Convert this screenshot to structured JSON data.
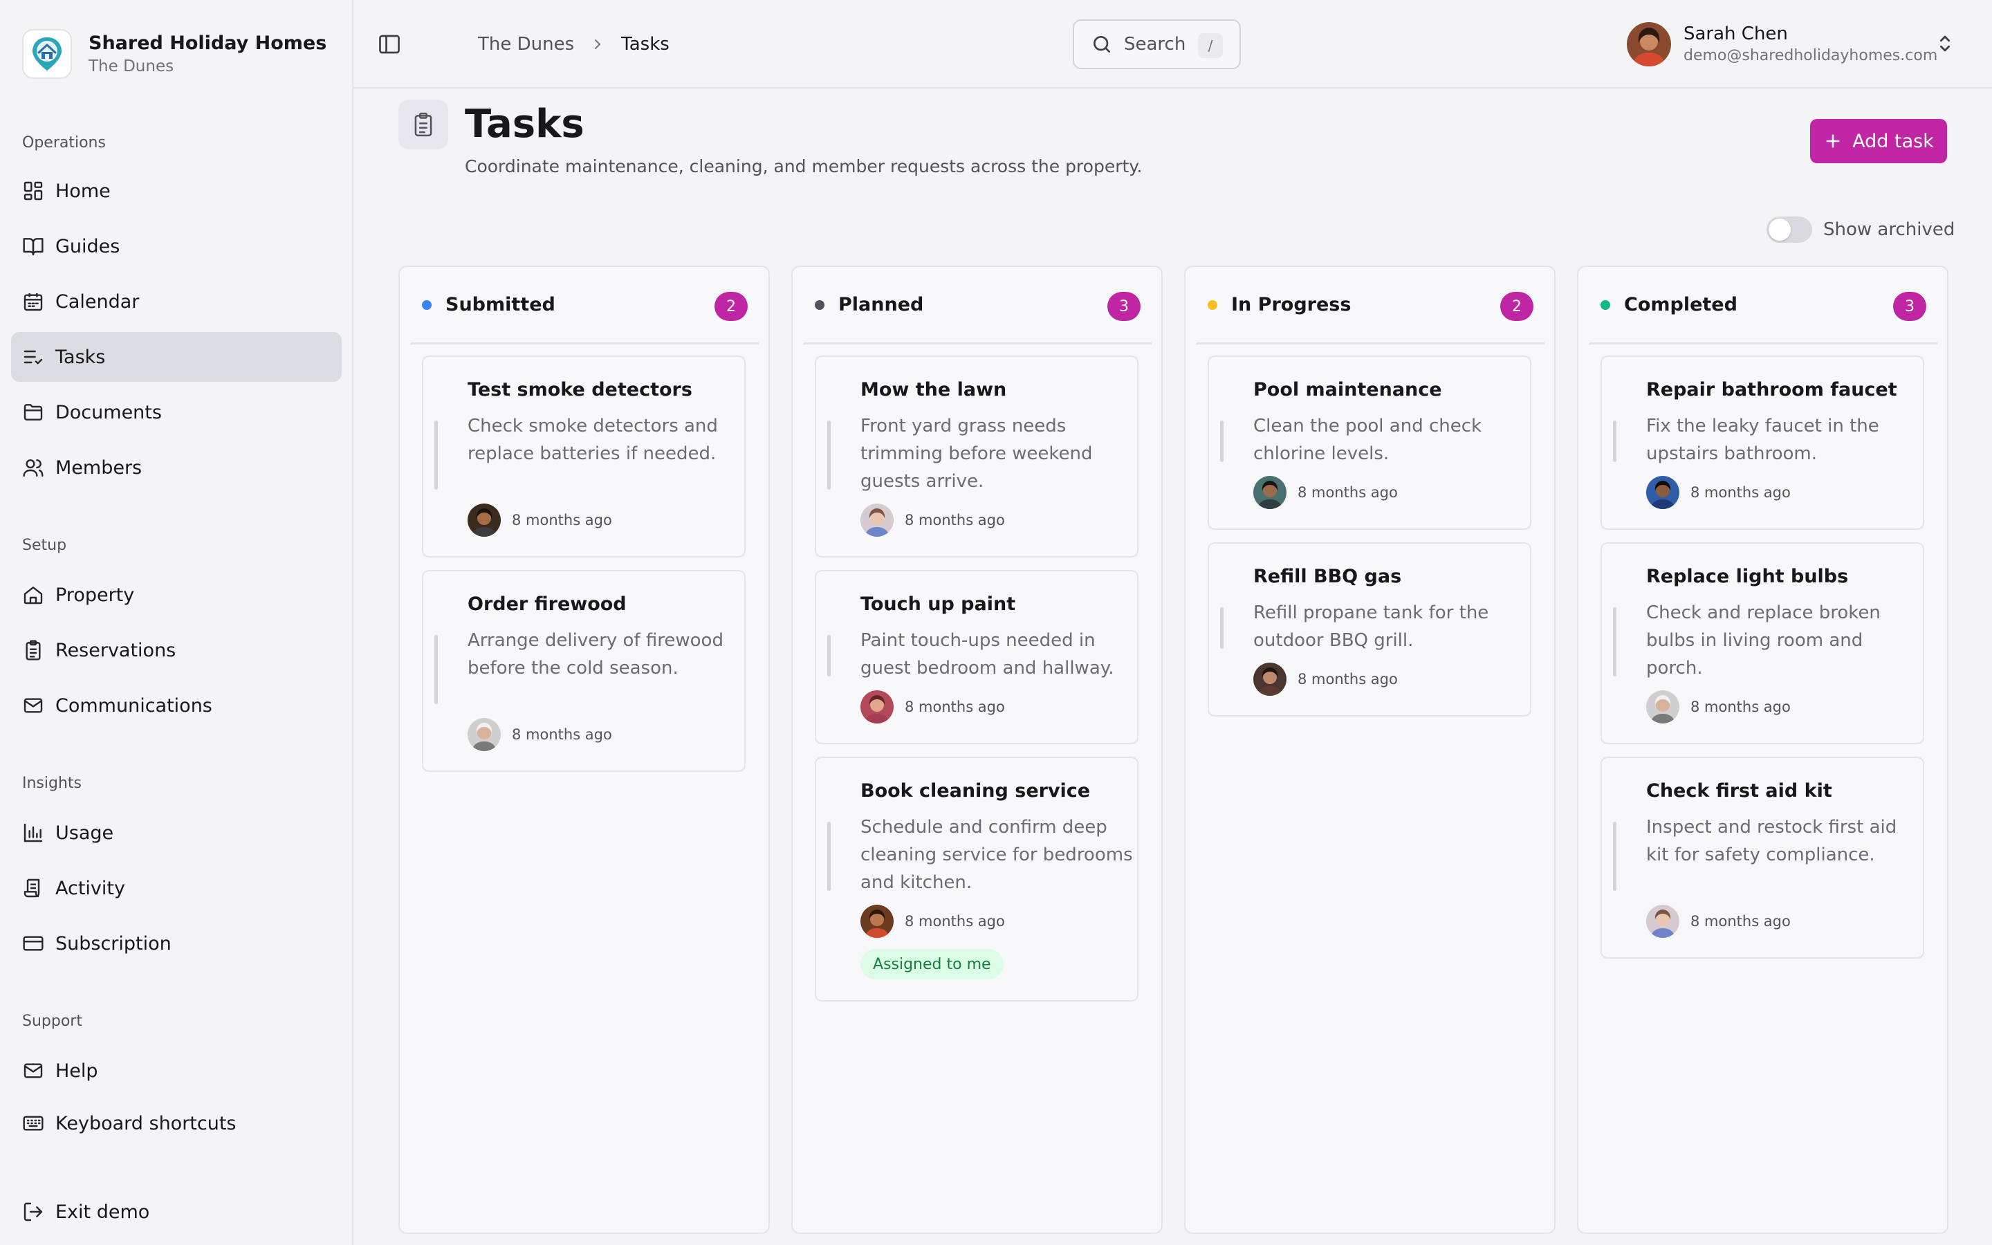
{
  "colors": {
    "accent": "#c026a3",
    "submitted": "#3b82f6",
    "planned": "#52525b",
    "in_progress": "#fbbf24",
    "completed": "#10b981",
    "assigned_bg": "#dcfce7",
    "assigned_text": "#15803d"
  },
  "org": {
    "name": "Shared Holiday Homes",
    "property": "The Dunes",
    "logo_icon": "house-logo-icon"
  },
  "sidebar": {
    "sections": [
      {
        "label": "Operations",
        "items": [
          {
            "label": "Home",
            "icon": "grid-icon"
          },
          {
            "label": "Guides",
            "icon": "book-icon"
          },
          {
            "label": "Calendar",
            "icon": "calendar-icon"
          },
          {
            "label": "Tasks",
            "icon": "list-check-icon",
            "active": true
          },
          {
            "label": "Documents",
            "icon": "folder-icon"
          },
          {
            "label": "Members",
            "icon": "users-icon"
          }
        ]
      },
      {
        "label": "Setup",
        "items": [
          {
            "label": "Property",
            "icon": "home-icon"
          },
          {
            "label": "Reservations",
            "icon": "clipboard-icon"
          },
          {
            "label": "Communications",
            "icon": "mail-icon"
          }
        ]
      },
      {
        "label": "Insights",
        "items": [
          {
            "label": "Usage",
            "icon": "bar-chart-icon"
          },
          {
            "label": "Activity",
            "icon": "scroll-icon"
          },
          {
            "label": "Subscription",
            "icon": "credit-card-icon"
          }
        ]
      },
      {
        "label": "Support",
        "items": [
          {
            "label": "Help",
            "icon": "mail-icon"
          },
          {
            "label": "Keyboard shortcuts",
            "icon": "keyboard-icon"
          }
        ]
      }
    ],
    "exit": {
      "label": "Exit demo",
      "icon": "exit-icon"
    }
  },
  "breadcrumb": {
    "parent": "The Dunes",
    "current": "Tasks"
  },
  "search": {
    "label": "Search",
    "shortcut": "/"
  },
  "user": {
    "name": "Sarah Chen",
    "email": "demo@sharedholidayhomes.com"
  },
  "page": {
    "title": "Tasks",
    "subtitle": "Coordinate maintenance, cleaning, and member requests across the property.",
    "add_button": "Add task",
    "archived_toggle": "Show archived",
    "archived_on": false
  },
  "board": {
    "columns": [
      {
        "title": "Submitted",
        "count": "2",
        "color_key": "submitted",
        "cards": [
          {
            "title": "Test smoke detectors",
            "description": "Check smoke detectors and replace batteries if needed.",
            "time": "8 months ago",
            "avatar": "man-cap"
          },
          {
            "title": "Order firewood",
            "description": "Arrange delivery of firewood before the cold season.",
            "time": "8 months ago",
            "avatar": "older-man"
          }
        ]
      },
      {
        "title": "Planned",
        "count": "3",
        "color_key": "planned",
        "cards": [
          {
            "title": "Mow the lawn",
            "description": "Front yard grass needs trimming before weekend guests arrive.",
            "time": "8 months ago",
            "avatar": "woman-light"
          },
          {
            "title": "Touch up paint",
            "description": "Paint touch-ups needed in guest bedroom and hallway.",
            "time": "8 months ago",
            "avatar": "woman-red"
          },
          {
            "title": "Book cleaning service",
            "description": "Schedule and confirm deep cleaning service for bedrooms and kitchen.",
            "time": "8 months ago",
            "avatar": "woman-dark",
            "tag": "Assigned to me"
          }
        ]
      },
      {
        "title": "In Progress",
        "count": "2",
        "color_key": "in_progress",
        "cards": [
          {
            "title": "Pool maintenance",
            "description": "Clean the pool and check chlorine levels.",
            "time": "8 months ago",
            "avatar": "man-teal"
          },
          {
            "title": "Refill BBQ gas",
            "description": "Refill propane tank for the outdoor BBQ grill.",
            "time": "8 months ago",
            "avatar": "woman-brown"
          }
        ]
      },
      {
        "title": "Completed",
        "count": "3",
        "color_key": "completed",
        "cards": [
          {
            "title": "Repair bathroom faucet",
            "description": "Fix the leaky faucet in the upstairs bathroom.",
            "time": "8 months ago",
            "avatar": "man-blue"
          },
          {
            "title": "Replace light bulbs",
            "description": "Check and replace broken bulbs in living room and porch.",
            "time": "8 months ago",
            "avatar": "older-man"
          },
          {
            "title": "Check first aid kit",
            "description": "Inspect and restock first aid kit for safety compliance.",
            "time": "8 months ago",
            "avatar": "woman-light"
          }
        ]
      }
    ]
  }
}
